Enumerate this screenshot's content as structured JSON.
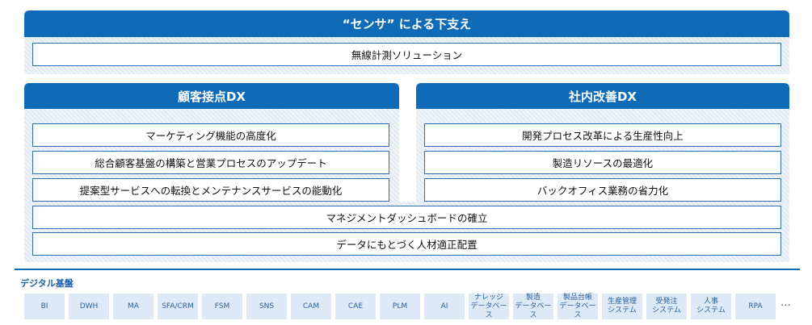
{
  "sensor": {
    "title": "“センサ” による下支え",
    "solution": "無線計測ソリューション"
  },
  "customer": {
    "title": "顧客接点DX",
    "items": [
      "マーケティング機能の高度化",
      "総合顧客基盤の構築と営業プロセスのアップデート",
      "提案型サービスへの転換とメンテナンスサービスの能動化"
    ]
  },
  "internal": {
    "title": "社内改善DX",
    "items": [
      "開発プロセス改革による生産性向上",
      "製造リソースの最適化",
      "バックオフィス業務の省力化"
    ]
  },
  "shared": {
    "items": [
      "マネジメントダッシュボードの確立",
      "データにもとづく人材適正配置"
    ]
  },
  "digital_base": {
    "label": "デジタル基盤",
    "chips": [
      "BI",
      "DWH",
      "MA",
      "SFA/CRM",
      "FSM",
      "SNS",
      "CAM",
      "CAE",
      "PLM",
      "AI",
      "ナレッジ\nデータベース",
      "製造\nデータベース",
      "製品台帳\nデータベース",
      "生産管理\nシステム",
      "受発注\nシステム",
      "人事\nシステム",
      "RPA"
    ],
    "more": "…"
  }
}
